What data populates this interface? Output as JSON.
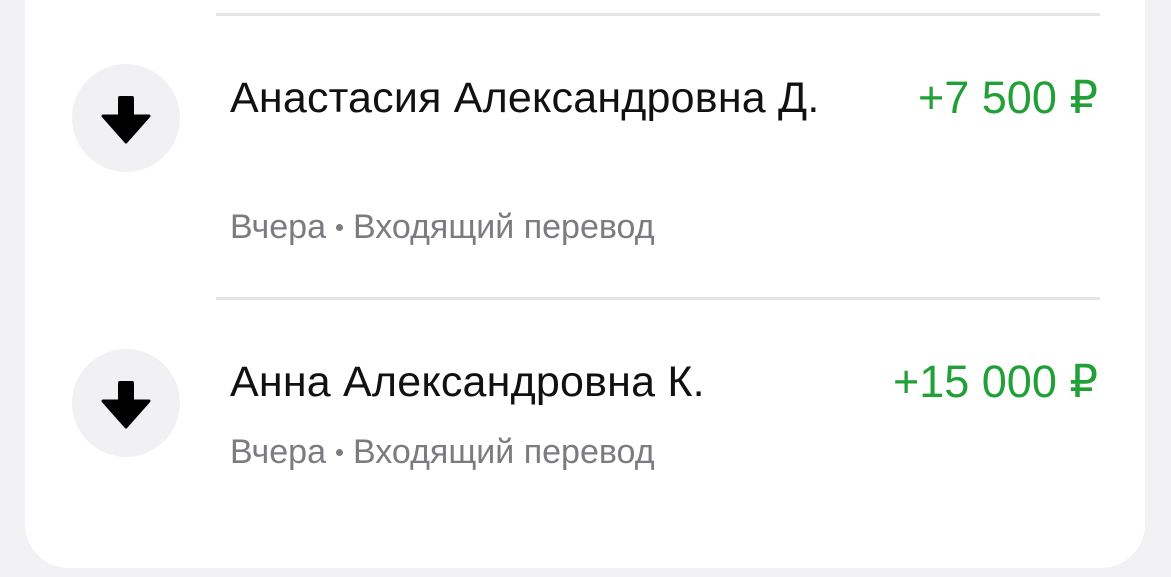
{
  "operations": [
    {
      "icon": "arrow-down-icon",
      "name": "Анастасия Александровна Д.",
      "date": "Вчера",
      "type": "Входящий перевод",
      "amount": "+7 500 ₽"
    },
    {
      "icon": "arrow-down-icon",
      "name": "Анна Александровна К.",
      "date": "Вчера",
      "type": "Входящий перевод",
      "amount": "+15 000 ₽"
    }
  ],
  "colors": {
    "amount_positive": "#21a038",
    "secondary_text": "#7b7b80",
    "primary_text": "#111111"
  }
}
